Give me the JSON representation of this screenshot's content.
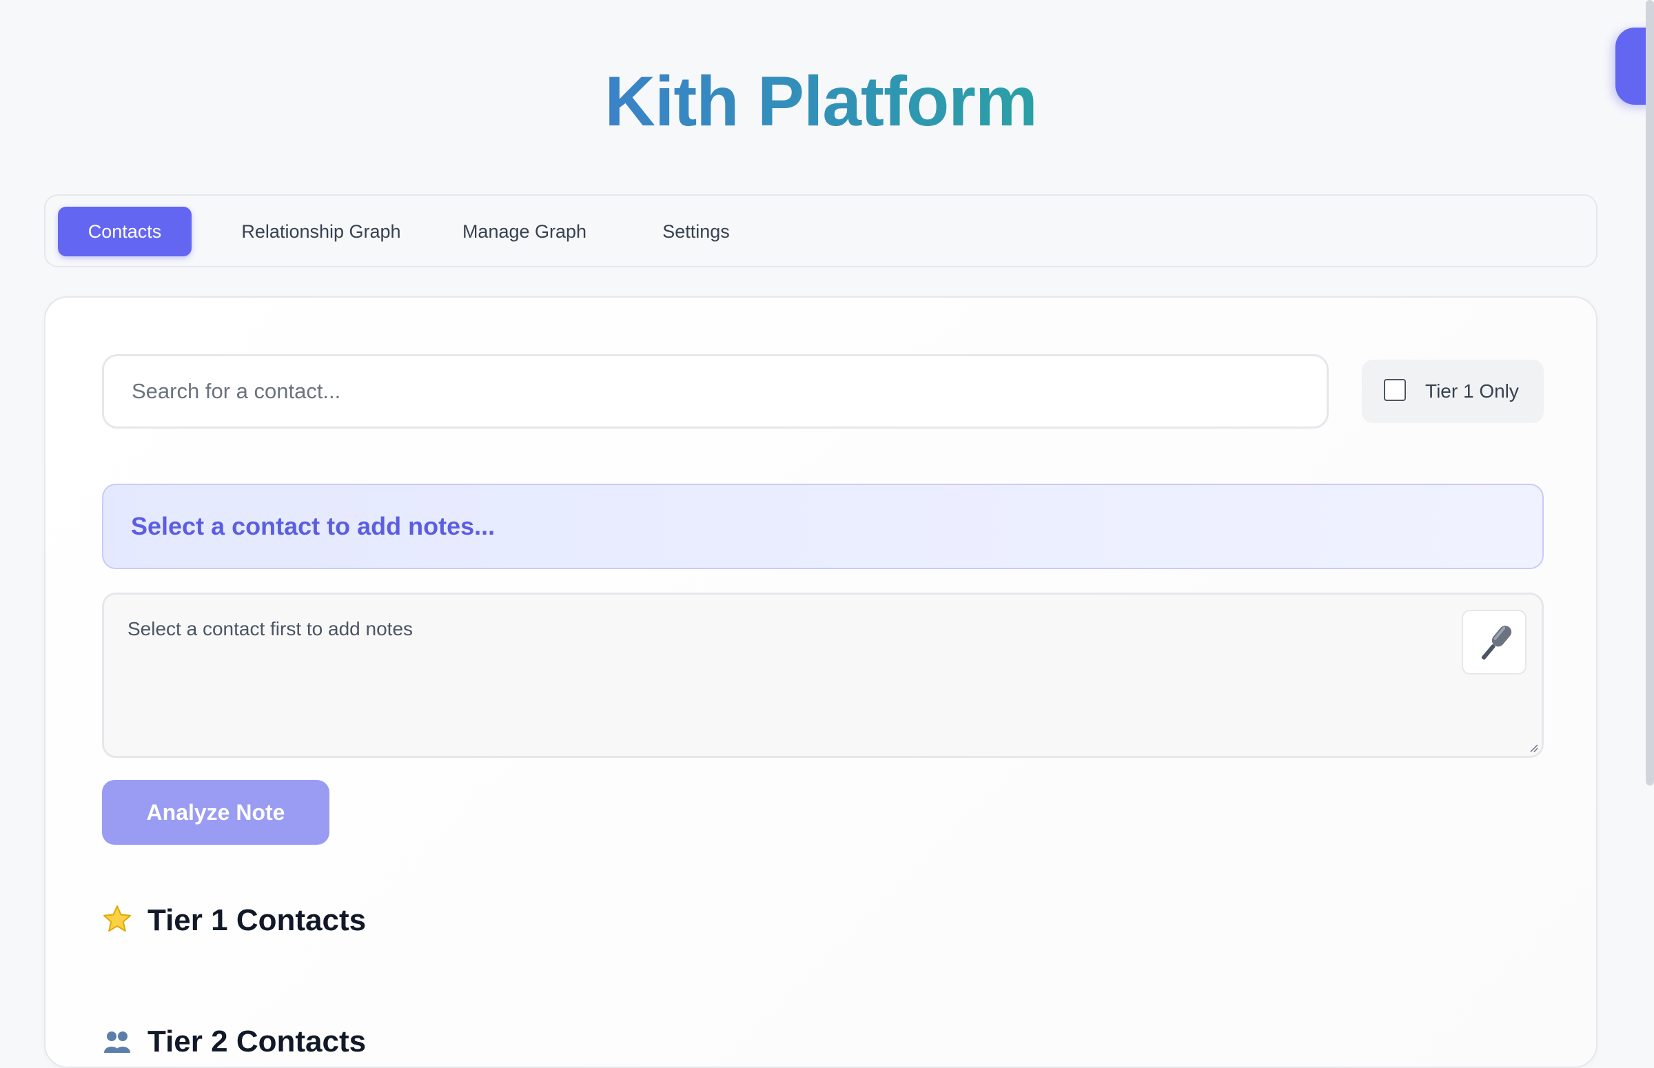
{
  "app": {
    "title": "Kith Platform"
  },
  "tabs": [
    {
      "label": "Contacts",
      "active": true
    },
    {
      "label": "Relationship Graph",
      "active": false
    },
    {
      "label": "Manage Graph",
      "active": false
    },
    {
      "label": "Settings",
      "active": false
    }
  ],
  "search": {
    "placeholder": "Search for a contact...",
    "value": ""
  },
  "filter": {
    "tier1_label": "Tier 1 Only",
    "tier1_checked": false
  },
  "notes": {
    "banner_text": "Select a contact to add notes...",
    "placeholder": "Select a contact first to add notes",
    "mic_icon": "microphone-icon",
    "analyze_label": "Analyze Note"
  },
  "sections": {
    "tier1_heading": "Tier 1 Contacts",
    "tier1_icon": "star-icon",
    "tier2_heading": "Tier 2 Contacts",
    "tier2_icon": "people-icon"
  },
  "colors": {
    "accent": "#6366f1",
    "title_gradient_start": "#3a82c8",
    "title_gradient_end": "#2aa0a6",
    "banner_text": "#5b5ee0"
  }
}
